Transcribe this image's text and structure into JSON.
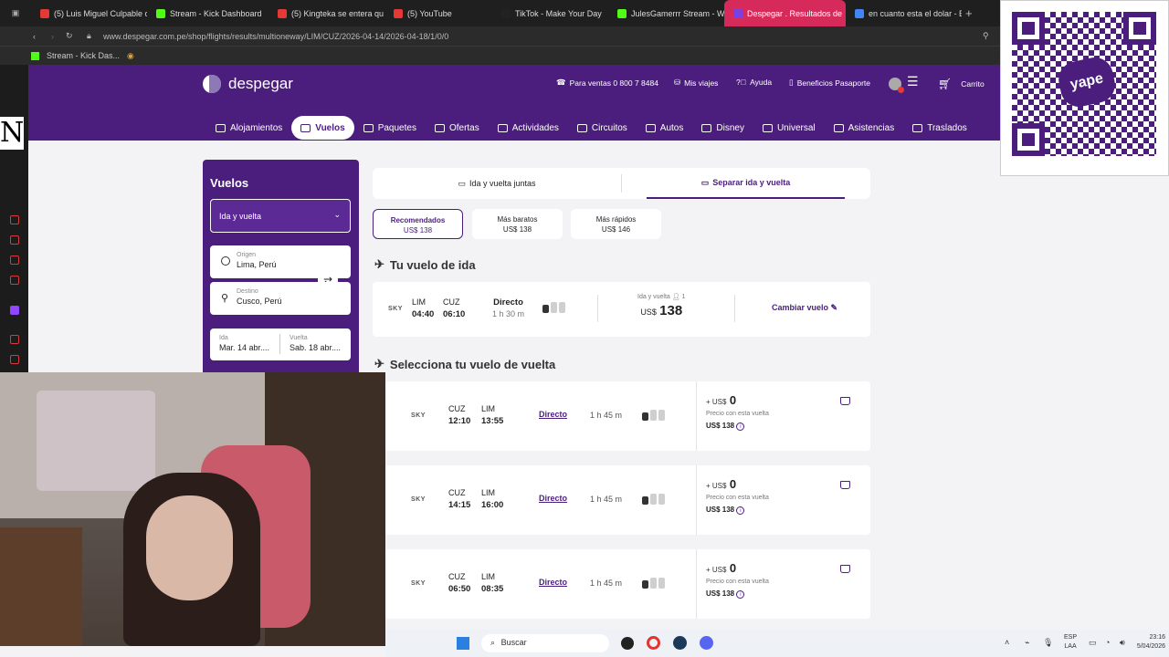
{
  "browser": {
    "tabs": [
      {
        "label": "(5) Luis Miguel Culpable o",
        "color": "#e53935"
      },
      {
        "label": "Stream - Kick Dashboard",
        "color": "#53fc18"
      },
      {
        "label": "(5) Kingteka se entera qu",
        "color": "#e53935"
      },
      {
        "label": "(5) YouTube",
        "color": "#e53935"
      },
      {
        "label": "TikTok - Make Your Day",
        "color": "#222"
      },
      {
        "label": "JulesGamerrr Stream - W",
        "color": "#53fc18"
      },
      {
        "label": "Despegar . Resultados de",
        "color": "#7b3fe4"
      },
      {
        "label": "en cuanto esta el dolar - B",
        "color": "#4285f4"
      }
    ],
    "url": "www.despegar.com.pe/shop/flights/results/multioneway/LIM/CUZ/2026-04-14/2026-04-18/1/0/0",
    "bookmark": "Stream - Kick Das..."
  },
  "header": {
    "brand": "despegar",
    "phone": "Para ventas 0 800 7 8484",
    "my_trips": "Mis viajes",
    "help": "Ayuda",
    "benefits": "Beneficios Pasaporte",
    "cart": "Carrito",
    "nav": [
      "Alojamientos",
      "Vuelos",
      "Paquetes",
      "Ofertas",
      "Actividades",
      "Circuitos",
      "Autos",
      "Disney",
      "Universal",
      "Asistencias",
      "Traslados"
    ],
    "active_nav": "Vuelos"
  },
  "search": {
    "title": "Vuelos",
    "trip_type": "Ida y vuelta",
    "origin_label": "Origen",
    "origin": "Lima, Perú",
    "destination_label": "Destino",
    "destination": "Cusco, Perú",
    "depart_label": "Ida",
    "depart": "Mar. 14 abr....",
    "return_label": "Vuelta",
    "return": "Sab. 18 abr...."
  },
  "results": {
    "toggle_together": "Ida y vuelta juntas",
    "toggle_separate": "Separar ida y vuelta",
    "sort": [
      {
        "label": "Recomendados",
        "price": "US$ 138"
      },
      {
        "label": "Más baratos",
        "price": "US$ 138"
      },
      {
        "label": "Más rápidos",
        "price": "US$ 146"
      }
    ],
    "outbound_title": "Tu vuelo de ida",
    "outbound": {
      "airline": "SKY",
      "from": "LIM",
      "dep": "04:40",
      "to": "CUZ",
      "arr": "06:10",
      "type": "Directo",
      "duration": "1 h 30 m",
      "summary_label": "Ida y vuelta",
      "passengers": "1",
      "currency": "US$",
      "price": "138",
      "change": "Cambiar vuelo"
    },
    "return_title": "Selecciona tu vuelo de vuelta",
    "returns": [
      {
        "airline": "SKY",
        "from": "CUZ",
        "dep": "12:10",
        "to": "LIM",
        "arr": "13:55",
        "type": "Directo",
        "duration": "1 h 45 m",
        "plus": "+ US$",
        "delta": "0",
        "note": "Precio con esta vuelta",
        "total": "US$ 138"
      },
      {
        "airline": "SKY",
        "from": "CUZ",
        "dep": "14:15",
        "to": "LIM",
        "arr": "16:00",
        "type": "Directo",
        "duration": "1 h 45 m",
        "plus": "+ US$",
        "delta": "0",
        "note": "Precio con esta vuelta",
        "total": "US$ 138"
      },
      {
        "airline": "SKY",
        "from": "CUZ",
        "dep": "06:50",
        "to": "LIM",
        "arr": "08:35",
        "type": "Directo",
        "duration": "1 h 45 m",
        "plus": "+ US$",
        "delta": "0",
        "note": "Precio con esta vuelta",
        "total": "US$ 138"
      }
    ]
  },
  "taskbar": {
    "search": "Buscar",
    "lang": "ESP",
    "lang2": "LAA",
    "time": "23:16",
    "date": "5/04/2026"
  },
  "overlay": {
    "qr_brand": "yape",
    "letter": "N"
  },
  "colors": {
    "brand": "#4b1e7e",
    "accent": "#d62b5a"
  }
}
